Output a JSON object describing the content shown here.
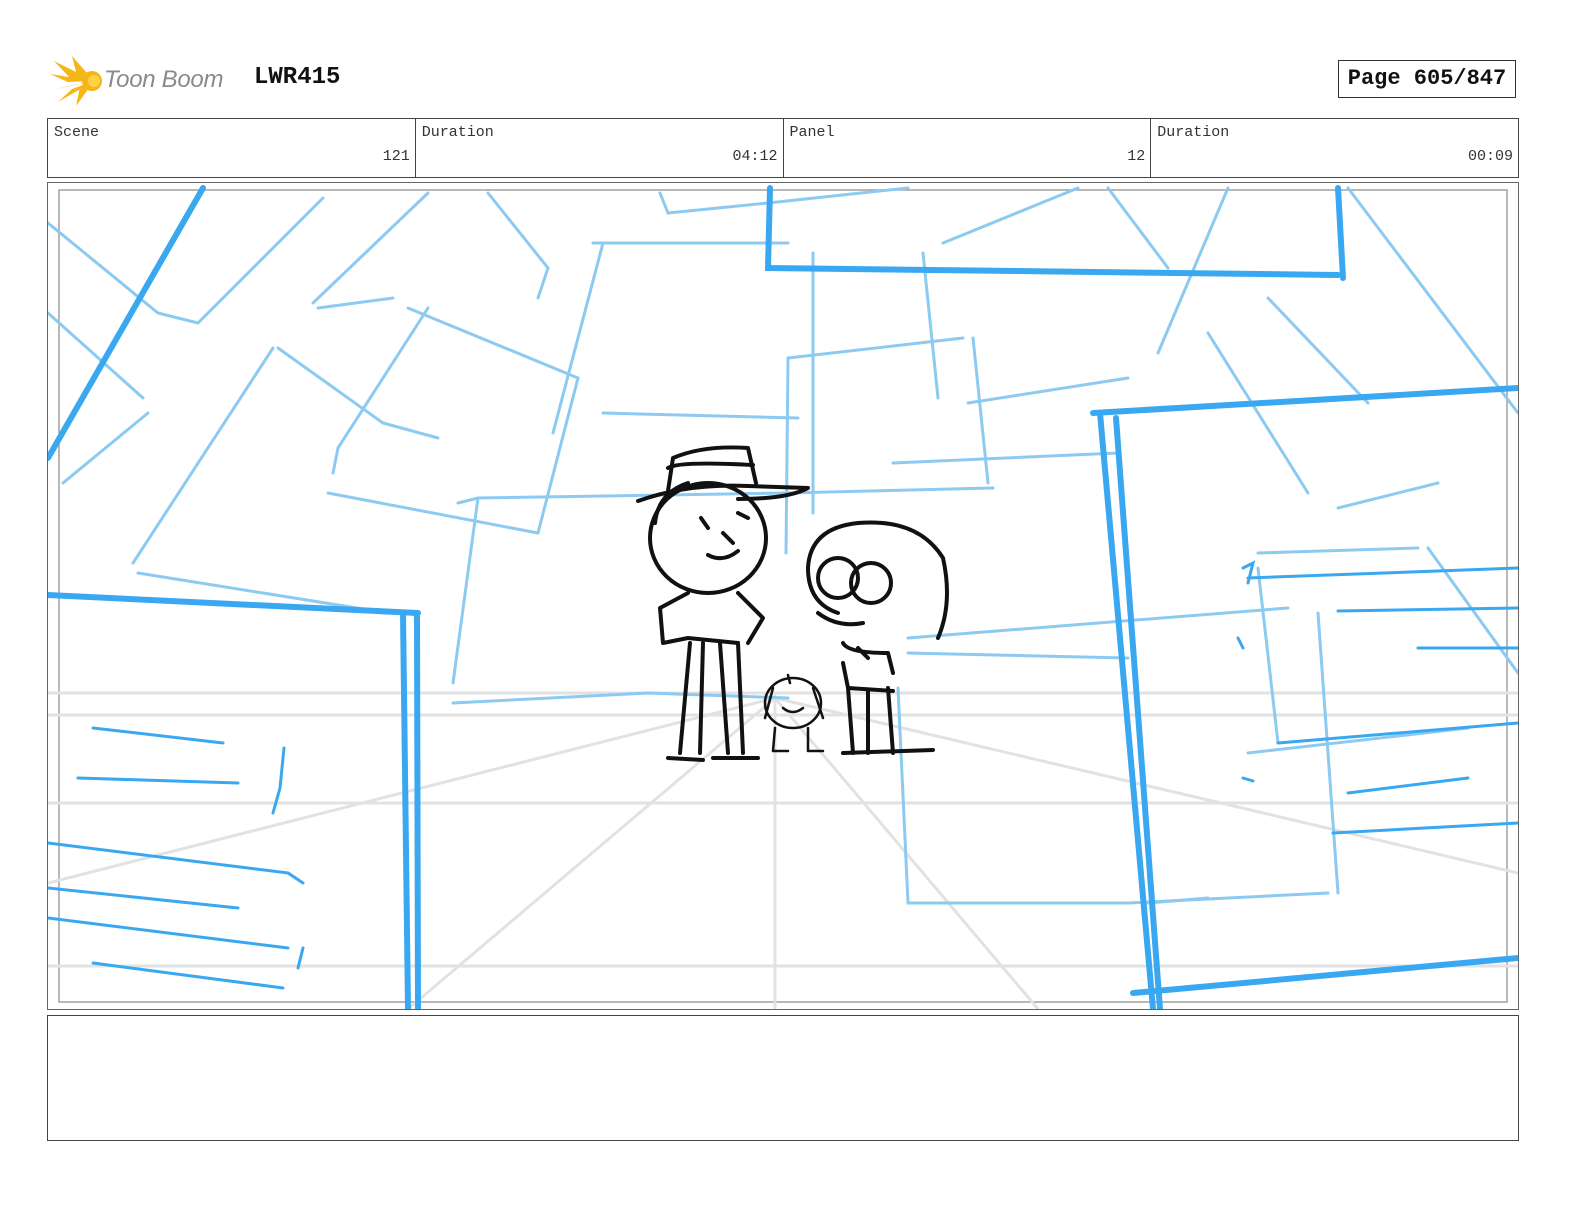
{
  "header": {
    "logo_text": "Toon Boom",
    "project_code": "LWR415",
    "page_label": "Page 605/847"
  },
  "info": [
    {
      "label": "Scene",
      "value": "121"
    },
    {
      "label": "Duration",
      "value": "04:12"
    },
    {
      "label": "Panel",
      "value": "12"
    },
    {
      "label": "Duration",
      "value": "00:09"
    }
  ],
  "colors": {
    "sketch_blue_dark": "#3aa8f0",
    "sketch_blue_light": "#8ccaf2",
    "ink": "#111111",
    "logo_yellow": "#f6b617"
  },
  "icons": {
    "logo": "starburst-icon"
  },
  "notes": ""
}
